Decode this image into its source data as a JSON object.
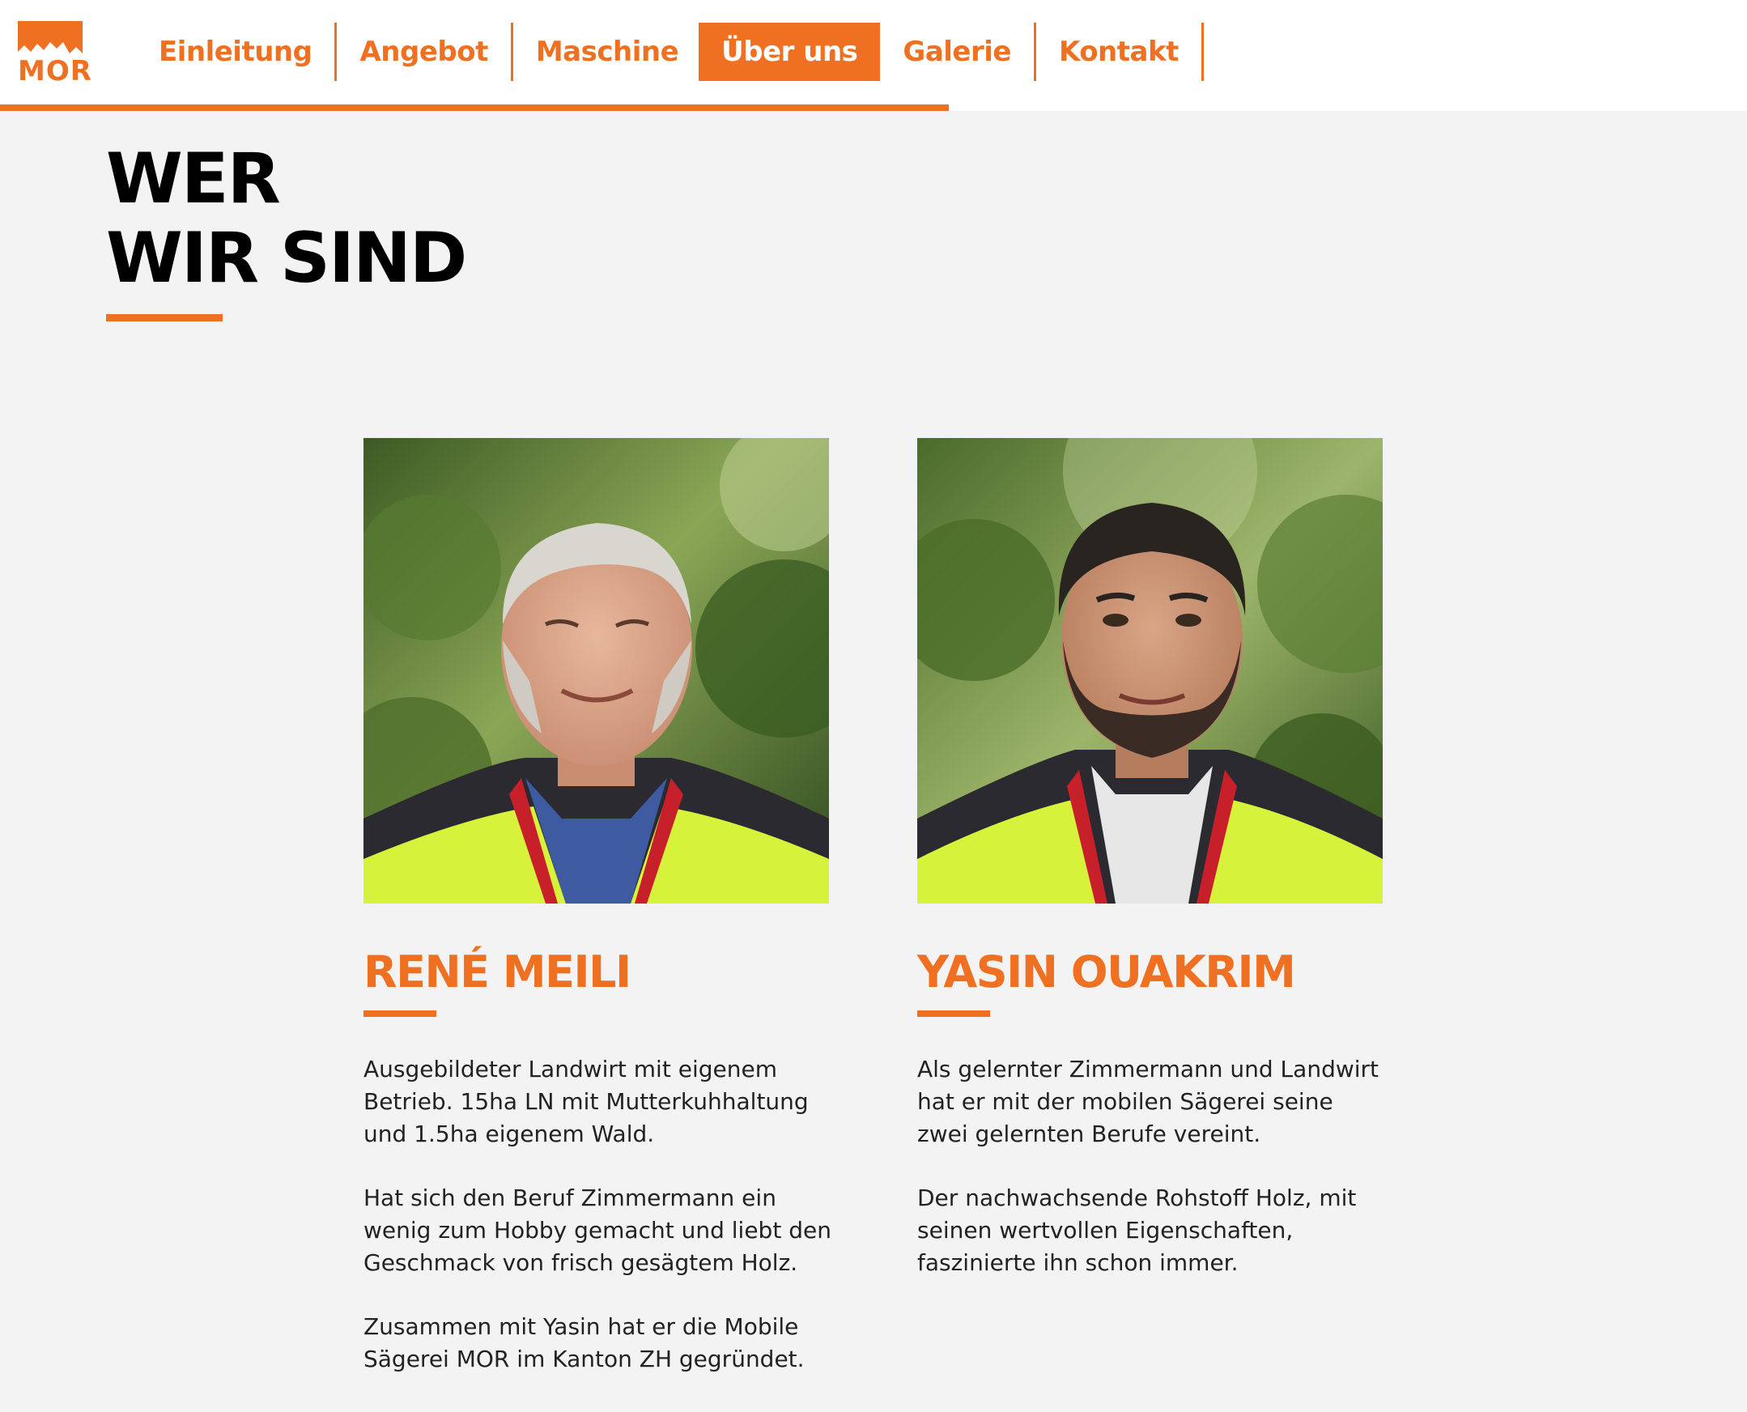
{
  "brand": {
    "logo_text": "MOR",
    "accent_color": "#f07022"
  },
  "nav": {
    "items": [
      {
        "label": "Einleitung"
      },
      {
        "label": "Angebot"
      },
      {
        "label": "Maschine"
      },
      {
        "label": "Über uns"
      },
      {
        "label": "Galerie"
      },
      {
        "label": "Kontakt"
      }
    ],
    "active": "Über uns"
  },
  "section": {
    "title_line1": "WER",
    "title_line2": "WIR SIND"
  },
  "team": [
    {
      "name": "RENÉ MEILI",
      "bio": [
        "Ausgebildeter Landwirt mit eigenem Betrieb. 15ha LN mit Mutterkuhhaltung und 1.5ha eigenem Wald.",
        "Hat sich den Beruf Zimmermann ein wenig zum Hobby gemacht und liebt den Geschmack von frisch gesägtem Holz.",
        "Zusammen mit Yasin hat er die Mobile Sägerei MOR im Kanton ZH gegründet."
      ]
    },
    {
      "name": "YASIN OUAKRIM",
      "bio": [
        "Als gelernter Zimmermann und Landwirt hat er mit der mobilen Sägerei seine zwei gelernten Berufe vereint.",
        "Der nachwachsende Rohstoff Holz, mit seinen wertvollen Eigenschaften, faszinierte ihn schon immer."
      ]
    }
  ]
}
